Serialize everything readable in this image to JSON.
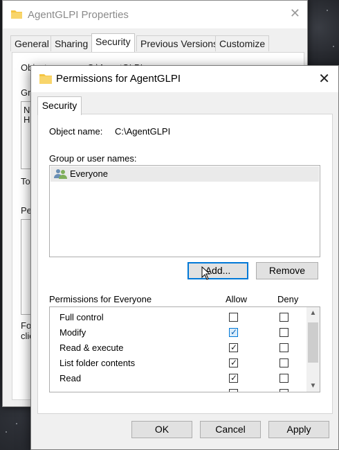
{
  "back_window": {
    "title": "AgentGLPI Properties",
    "tabs": [
      "General",
      "Sharing",
      "Security",
      "Previous Versions",
      "Customize"
    ],
    "active_tab": "Security",
    "fragments": {
      "object_name": "Object name:",
      "object_value": "C:\\AgentGLPI",
      "group": "Gro",
      "list_a": "No",
      "list_b": "Ho",
      "to": "To",
      "pe": "Pe",
      "for_a": "For",
      "for_b": "clic"
    }
  },
  "dialog": {
    "title": "Permissions for AgentGLPI",
    "tab": "Security",
    "object_name_label": "Object name:",
    "object_name_value": "C:\\AgentGLPI",
    "group_label": "Group or user names:",
    "users": [
      {
        "name": "Everyone",
        "icon": "users-group-icon",
        "selected": true
      }
    ],
    "add_button": "Add...",
    "remove_button": "Remove",
    "permissions_label": "Permissions for Everyone",
    "allow_label": "Allow",
    "deny_label": "Deny",
    "permissions": [
      {
        "name": "Full control",
        "allow": false,
        "deny": false
      },
      {
        "name": "Modify",
        "allow": true,
        "deny": false,
        "hover": true
      },
      {
        "name": "Read & execute",
        "allow": true,
        "deny": false
      },
      {
        "name": "List folder contents",
        "allow": true,
        "deny": false
      },
      {
        "name": "Read",
        "allow": true,
        "deny": false
      },
      {
        "name": "",
        "allow": true,
        "deny": false,
        "partial": true
      }
    ],
    "ok_button": "OK",
    "cancel_button": "Cancel",
    "apply_button": "Apply"
  },
  "colors": {
    "accent": "#0078d7",
    "folder": "#f5c542"
  }
}
